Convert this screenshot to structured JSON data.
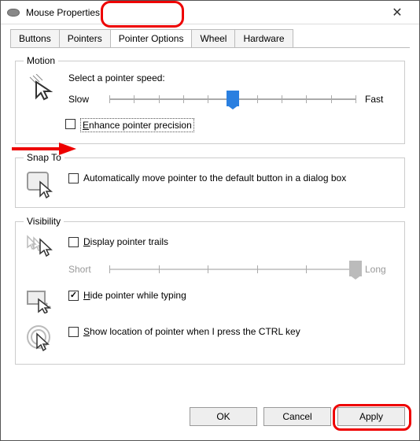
{
  "title": "Mouse Properties",
  "tabs": [
    "Buttons",
    "Pointers",
    "Pointer Options",
    "Wheel",
    "Hardware"
  ],
  "active_tab": 2,
  "motion": {
    "legend": "Motion",
    "speed_label": "Select a pointer speed:",
    "slow": "Slow",
    "fast": "Fast",
    "slider_ticks": 11,
    "slider_value": 5,
    "enhance_label_pre": "E",
    "enhance_label_rest": "nhance pointer precision",
    "enhance_checked": false
  },
  "snapto": {
    "legend": "Snap To",
    "auto_label_pre": "",
    "auto_label": "Automatically move pointer to the default button in a dialog box",
    "auto_checked": false
  },
  "visibility": {
    "legend": "Visibility",
    "trails_label_pre": "D",
    "trails_label_rest": "isplay pointer trails",
    "trails_checked": false,
    "short": "Short",
    "long": "Long",
    "trail_ticks": 6,
    "trail_value": 5,
    "hide_label_pre": "H",
    "hide_label_rest": "ide pointer while typing",
    "hide_checked": true,
    "show_label_pre": "S",
    "show_label_rest": "how location of pointer when I press the CTRL key",
    "show_checked": false
  },
  "buttons": {
    "ok": "OK",
    "cancel": "Cancel",
    "apply": "Apply"
  }
}
